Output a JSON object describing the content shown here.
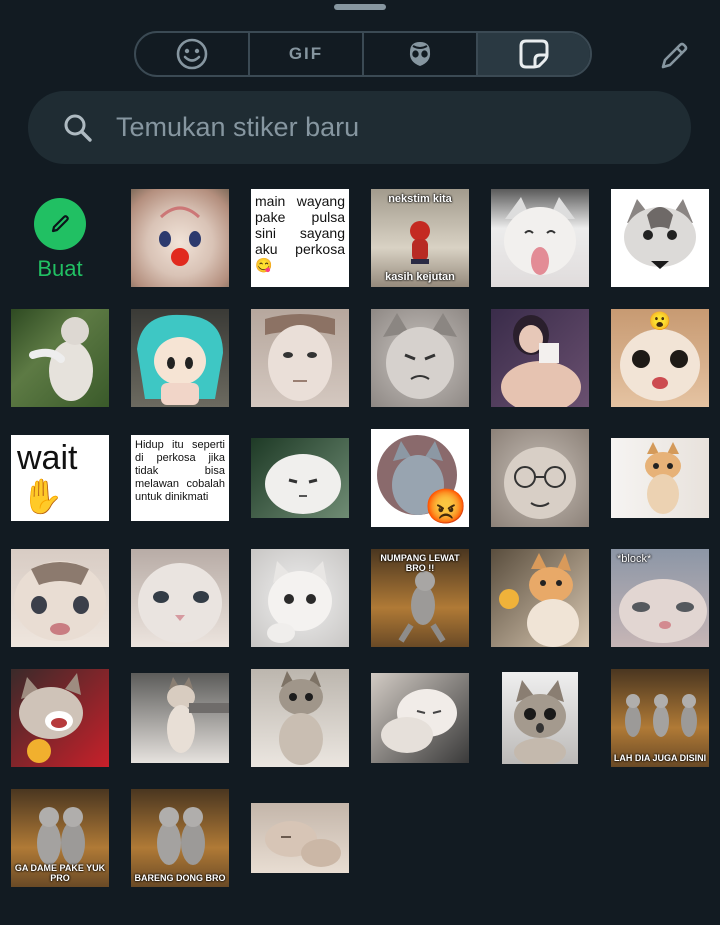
{
  "tabs": [
    {
      "icon": "emoji-icon",
      "active": false
    },
    {
      "label": "GIF",
      "active": false
    },
    {
      "icon": "avatar-icon",
      "active": false
    },
    {
      "icon": "sticker-icon",
      "active": true
    }
  ],
  "search": {
    "placeholder": "Temukan stiker baru"
  },
  "create": {
    "label": "Buat"
  },
  "stickers": [
    {
      "kind": "clown"
    },
    {
      "kind": "text",
      "text": "main wayang pake pulsa sini sayang aku perkosa 😋"
    },
    {
      "kind": "caption",
      "top": "nekstim kita",
      "bottom": "kasih kejutan"
    },
    {
      "kind": "cat-tongue"
    },
    {
      "kind": "cat-white"
    },
    {
      "kind": "cat-outdoor"
    },
    {
      "kind": "figure-teal"
    },
    {
      "kind": "face-pale"
    },
    {
      "kind": "cat-grey"
    },
    {
      "kind": "photo-blurred"
    },
    {
      "kind": "cat-emoji",
      "emoji": "😮"
    },
    {
      "kind": "wait",
      "text": "wait",
      "emoji": "✋"
    },
    {
      "kind": "text-small",
      "text": "Hidup itu seperti di perkosa jika tidak bisa melawan cobalah untuk dinikmati"
    },
    {
      "kind": "cat-flat"
    },
    {
      "kind": "cat-circle",
      "emoji": "😡"
    },
    {
      "kind": "cat-glasses"
    },
    {
      "kind": "kitten-orange"
    },
    {
      "kind": "kitten-close"
    },
    {
      "kind": "kitten-white"
    },
    {
      "kind": "kitten-grey"
    },
    {
      "kind": "dance",
      "top": "NUMPANG LEWAT BRO !!"
    },
    {
      "kind": "cat-fist"
    },
    {
      "kind": "cat-block",
      "top": "*block*"
    },
    {
      "kind": "cat-scream"
    },
    {
      "kind": "cat-standing"
    },
    {
      "kind": "cat-standing2"
    },
    {
      "kind": "cat-lying"
    },
    {
      "kind": "cat-shock"
    },
    {
      "kind": "dance3",
      "bottom": "LAH DIA JUGA DISINI"
    },
    {
      "kind": "dance2",
      "bottom": "GA DAME PAKE YUK PRO"
    },
    {
      "kind": "dance2",
      "bottom": "BARENG DONG BRO"
    },
    {
      "kind": "cat-sleep"
    }
  ]
}
